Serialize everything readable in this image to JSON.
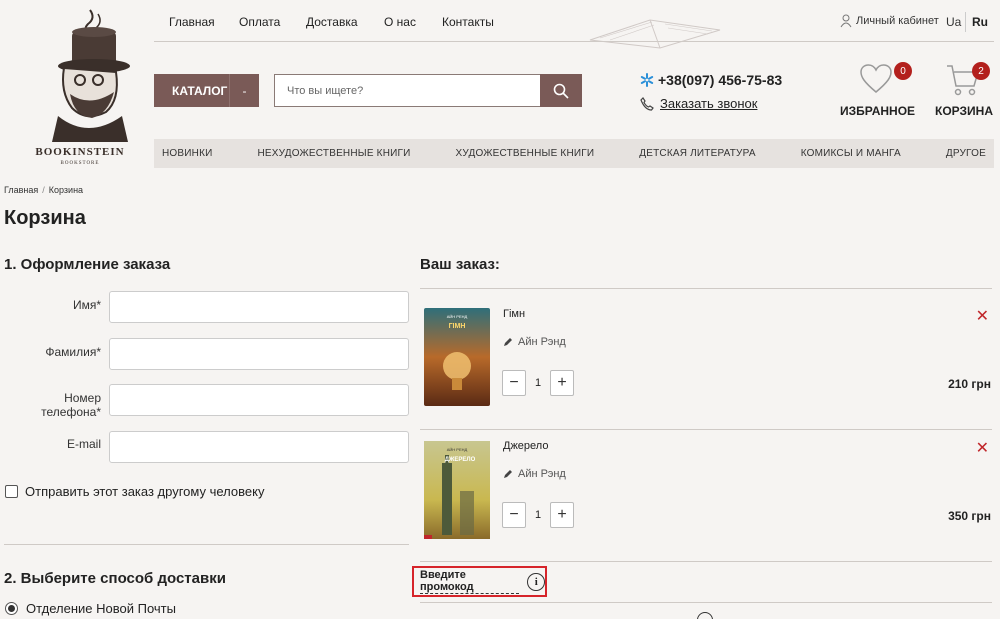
{
  "brand": {
    "name": "BOOKINSTEIN",
    "sub": "BOOKSTORE"
  },
  "topnav": [
    "Главная",
    "Оплата",
    "Доставка",
    "О нас",
    "Контакты"
  ],
  "account": {
    "label": "Личный кабинет",
    "lang_ua": "Ua",
    "lang_ru": "Ru"
  },
  "catalog_label": "КАТАЛОГ",
  "catalog_dash": "-",
  "search": {
    "placeholder": "Что вы ищете?"
  },
  "contact": {
    "phone": "+38(097) 456-75-83",
    "callback": "Заказать звонок"
  },
  "favorites": {
    "label": "ИЗБРАННОЕ",
    "count": "0"
  },
  "cart": {
    "label": "КОРЗИНА",
    "count": "2"
  },
  "categories": [
    "НОВИНКИ",
    "НЕХУДОЖЕСТВЕННЫЕ КНИГИ",
    "ХУДОЖЕСТВЕННЫЕ КНИГИ",
    "ДЕТСКАЯ ЛИТЕРАТУРА",
    "КОМИКСЫ И МАНГА",
    "ДРУГОЕ"
  ],
  "breadcrumb": [
    "Главная",
    "/",
    "Корзина"
  ],
  "page_title": "Корзина",
  "checkout": {
    "section1": "1. Оформление заказа",
    "fields": [
      "Имя*",
      "Фамилия*",
      "Номер телефона*",
      "E-mail"
    ],
    "other_person": "Отправить этот заказ другому человеку",
    "section2": "2. Выберите способ доставки",
    "delivery_option": "Отделение Новой Почты"
  },
  "order": {
    "title": "Ваш заказ:",
    "items": [
      {
        "name": "Гімн",
        "author": "Айн Рэнд",
        "qty": "1",
        "price": "210 грн",
        "cover_title": "ГІМН",
        "cover_author": "АЙН РЕНД"
      },
      {
        "name": "Джерело",
        "author": "Айн Рэнд",
        "qty": "1",
        "price": "350 грн",
        "cover_title": "ДЖЕРЕЛО",
        "cover_author": "АЙН РЕНД"
      }
    ],
    "minus": "−",
    "plus": "+",
    "remove": "✕",
    "promo_label": "Введите промокод",
    "info": "i"
  },
  "colors": {
    "accent": "#7a5a57",
    "badge": "#b3201d",
    "remove": "#c0262a",
    "highlight": "#d6242a"
  }
}
